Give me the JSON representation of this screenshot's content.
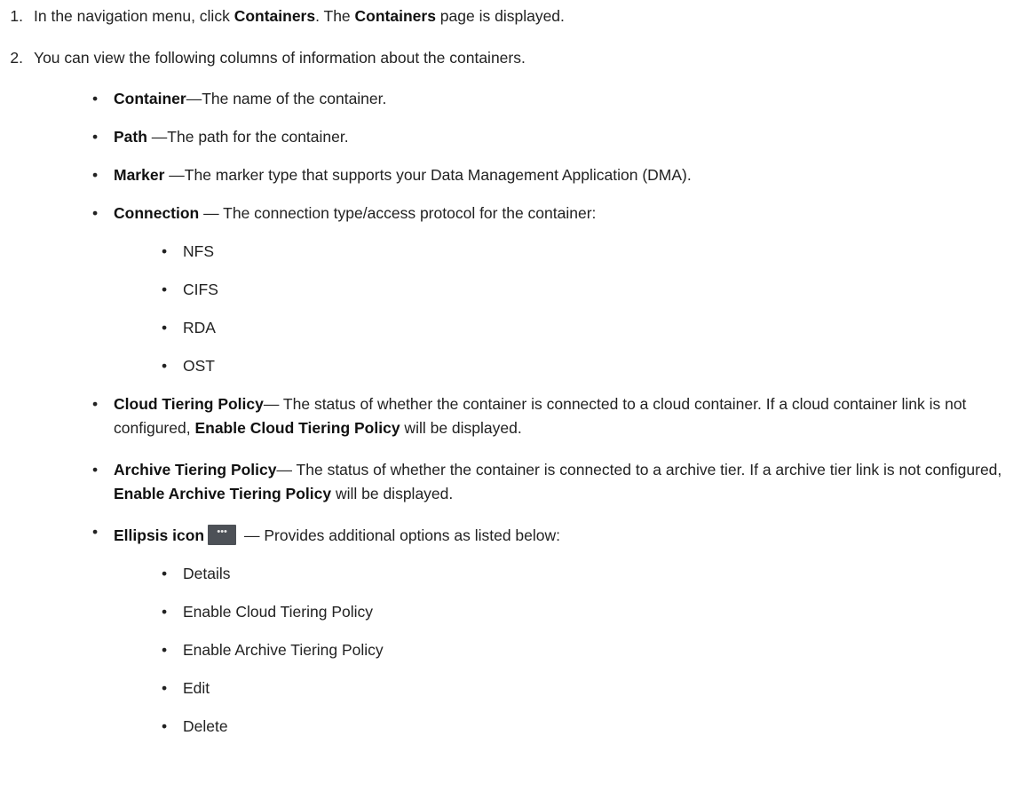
{
  "step1": {
    "num": "1.",
    "pre": "In the navigation menu, click ",
    "b1": "Containers",
    "mid": ". The ",
    "b2": "Containers",
    "post": " page is displayed."
  },
  "step2": {
    "num": "2.",
    "text": "You can view the following columns of information about the containers."
  },
  "bullet_glyph": "•",
  "columns": [
    {
      "label": "Container",
      "desc": "—The name of the container."
    },
    {
      "label": "Path",
      "desc": " —The path for the container."
    },
    {
      "label": "Marker",
      "desc": " —The marker type that supports your Data Management Application (DMA)."
    },
    {
      "label": "Connection",
      "desc": " — The connection type/access protocol for the container:"
    }
  ],
  "connection_types": [
    "NFS",
    "CIFS",
    "RDA",
    "OST"
  ],
  "cloud": {
    "label": "Cloud Tiering Policy",
    "desc1": "— The status of whether the container is connected to a cloud container. If a cloud container link is not configured, ",
    "bold": "Enable Cloud Tiering Policy",
    "desc2": " will be displayed."
  },
  "archive": {
    "label": "Archive Tiering Policy",
    "desc1": "— The status of whether the container is connected to a archive tier. If a archive tier link is not configured, ",
    "bold": "Enable Archive Tiering Policy",
    "desc2": " will be displayed."
  },
  "ellipsis": {
    "label": "Ellipsis icon",
    "icon_glyph": "•••",
    "desc": " — Provides additional options as listed below:"
  },
  "ellipsis_options": [
    "Details",
    "Enable Cloud Tiering Policy",
    "Enable Archive Tiering Policy",
    "Edit",
    "Delete"
  ]
}
